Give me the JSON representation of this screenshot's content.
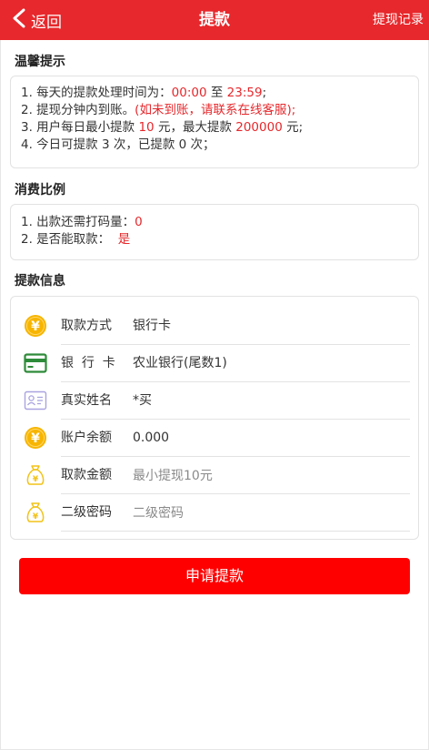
{
  "header": {
    "back_label": "返回",
    "title": "提款",
    "right_link": "提现记录",
    "color": "#e7282c"
  },
  "tips": {
    "title": "温馨提示",
    "line1": {
      "prefix": "1. 每天的提款处理时间为：",
      "start": "00:00",
      "mid": " 至 ",
      "end": "23:59",
      "suffix": ";"
    },
    "line2": {
      "prefix": "2. 提现分钟内到账。",
      "note": "(如未到账，请联系在线客服);"
    },
    "line3": {
      "prefix": "3. 用户每日最小提款 ",
      "min": "10",
      "mid": " 元，最大提款 ",
      "max": "200000",
      "suffix": " 元;"
    },
    "line4": "4. 今日可提款 3 次，已提款 0 次；"
  },
  "ratio": {
    "title": "消费比例",
    "line1": {
      "prefix": "1. 出款还需打码量：",
      "value": "0"
    },
    "line2": {
      "prefix": "2. 是否能取款：  ",
      "value": "是"
    }
  },
  "info": {
    "title": "提款信息",
    "rows": [
      {
        "icon": "yen-coin-icon",
        "label": "取款方式",
        "value": "银行卡"
      },
      {
        "icon": "bank-card-icon",
        "label": "银  行  卡",
        "value": "农业银行(尾数1)"
      },
      {
        "icon": "id-card-icon",
        "label": "真实姓名",
        "value": "*买"
      },
      {
        "icon": "yen-coin-icon",
        "label": "账户余额",
        "value": "0.000"
      },
      {
        "icon": "money-bag-icon",
        "label": "取款金额",
        "placeholder": "最小提现10元"
      },
      {
        "icon": "money-bag-icon",
        "label": "二级密码",
        "placeholder": "二级密码"
      }
    ]
  },
  "submit_label": "申请提款",
  "colors": {
    "accent": "#e5282c",
    "button": "#ff0000"
  }
}
